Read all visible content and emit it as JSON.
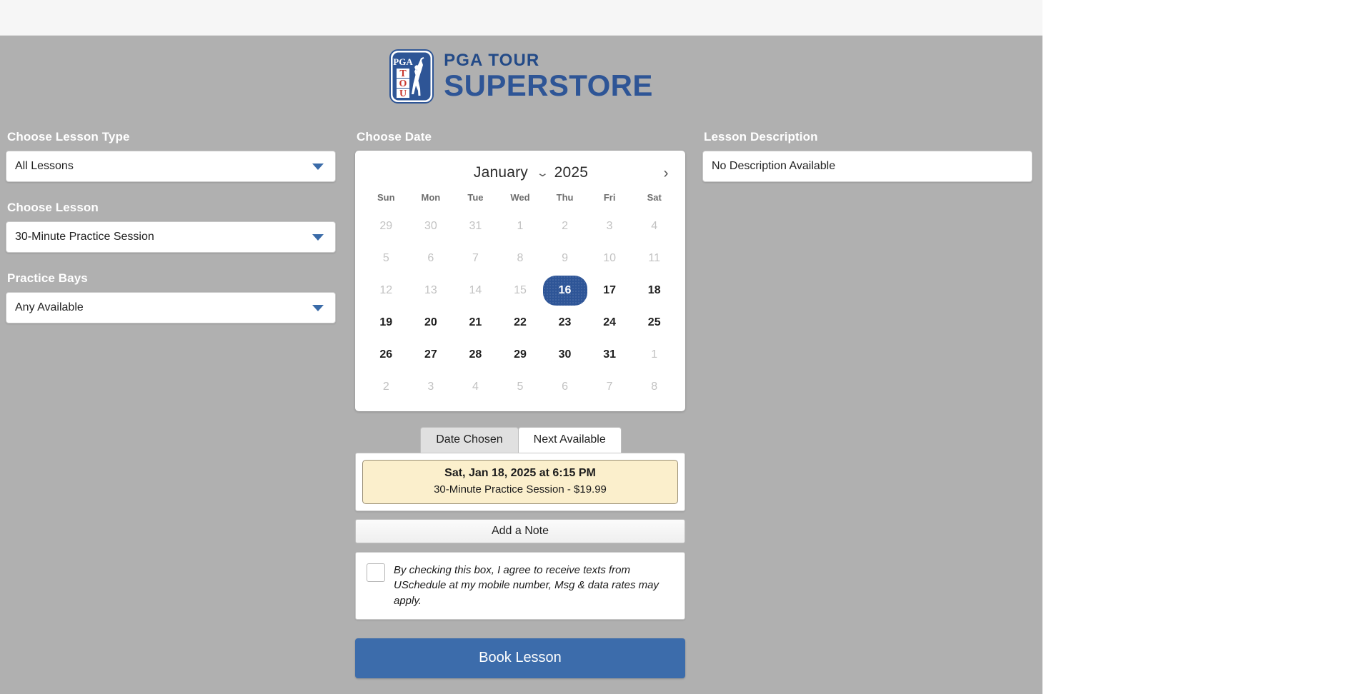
{
  "brand": {
    "logo_line1": "PGA TOUR",
    "logo_line2": "SUPERSTORE",
    "shield_pga": "PGA",
    "shield_tour": "TOUR",
    "accent_blue": "#2e5596",
    "accent_red": "#c8372d"
  },
  "left_panel": {
    "lesson_type": {
      "label": "Choose Lesson Type",
      "value": "All Lessons"
    },
    "lesson": {
      "label": "Choose Lesson",
      "value": "30-Minute Practice Session"
    },
    "bays": {
      "label": "Practice Bays",
      "value": "Any Available"
    }
  },
  "right_panel": {
    "label": "Lesson Description",
    "value": "No Description Available"
  },
  "calendar": {
    "label": "Choose Date",
    "month": "January",
    "year": "2025",
    "next_icon": "›",
    "month_chevron_icon": "⌄",
    "weekdays": [
      "Sun",
      "Mon",
      "Tue",
      "Wed",
      "Thu",
      "Fri",
      "Sat"
    ],
    "weeks": [
      [
        {
          "d": "29",
          "state": "disabled"
        },
        {
          "d": "30",
          "state": "disabled"
        },
        {
          "d": "31",
          "state": "disabled"
        },
        {
          "d": "1",
          "state": "disabled"
        },
        {
          "d": "2",
          "state": "disabled"
        },
        {
          "d": "3",
          "state": "disabled"
        },
        {
          "d": "4",
          "state": "disabled"
        }
      ],
      [
        {
          "d": "5",
          "state": "disabled"
        },
        {
          "d": "6",
          "state": "disabled"
        },
        {
          "d": "7",
          "state": "disabled"
        },
        {
          "d": "8",
          "state": "disabled"
        },
        {
          "d": "9",
          "state": "disabled"
        },
        {
          "d": "10",
          "state": "disabled"
        },
        {
          "d": "11",
          "state": "disabled"
        }
      ],
      [
        {
          "d": "12",
          "state": "disabled"
        },
        {
          "d": "13",
          "state": "disabled"
        },
        {
          "d": "14",
          "state": "disabled"
        },
        {
          "d": "15",
          "state": "disabled"
        },
        {
          "d": "16",
          "state": "selected"
        },
        {
          "d": "17",
          "state": "enabled"
        },
        {
          "d": "18",
          "state": "enabled"
        }
      ],
      [
        {
          "d": "19",
          "state": "enabled"
        },
        {
          "d": "20",
          "state": "enabled"
        },
        {
          "d": "21",
          "state": "enabled"
        },
        {
          "d": "22",
          "state": "enabled"
        },
        {
          "d": "23",
          "state": "enabled"
        },
        {
          "d": "24",
          "state": "enabled"
        },
        {
          "d": "25",
          "state": "enabled"
        }
      ],
      [
        {
          "d": "26",
          "state": "enabled"
        },
        {
          "d": "27",
          "state": "enabled"
        },
        {
          "d": "28",
          "state": "enabled"
        },
        {
          "d": "29",
          "state": "enabled"
        },
        {
          "d": "30",
          "state": "enabled"
        },
        {
          "d": "31",
          "state": "enabled"
        },
        {
          "d": "1",
          "state": "disabled"
        }
      ],
      [
        {
          "d": "2",
          "state": "disabled"
        },
        {
          "d": "3",
          "state": "disabled"
        },
        {
          "d": "4",
          "state": "disabled"
        },
        {
          "d": "5",
          "state": "disabled"
        },
        {
          "d": "6",
          "state": "disabled"
        },
        {
          "d": "7",
          "state": "disabled"
        },
        {
          "d": "8",
          "state": "disabled"
        }
      ]
    ]
  },
  "tabs": [
    {
      "label": "Date Chosen",
      "active": false
    },
    {
      "label": "Next Available",
      "active": true
    }
  ],
  "slot": {
    "time": "Sat, Jan 18, 2025 at 6:15 PM",
    "description": "30-Minute Practice Session - $19.99"
  },
  "note_button": "Add a Note",
  "consent": {
    "text": "By checking this box, I agree to receive texts from USchedule at my mobile number, Msg & data rates may apply.",
    "checked": false
  },
  "book_button": "Book Lesson"
}
